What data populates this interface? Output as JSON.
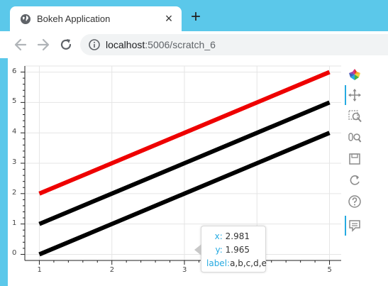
{
  "browser": {
    "tab_title": "Bokeh Application",
    "tab_close": "×",
    "new_tab": "+",
    "url_host": "localhost",
    "url_path": ":5006/scratch_6"
  },
  "tooltip": {
    "x_key": "x:",
    "x_value": "2.981",
    "y_key": "y:",
    "y_value": "1.965",
    "label_key": "label:",
    "label_value": "a,b,c,d,e"
  },
  "toolbar": {
    "tools": [
      "bokeh-logo-icon",
      "pan-icon",
      "box-zoom-icon",
      "wheel-zoom-icon",
      "save-icon",
      "reset-icon",
      "help-icon",
      "hover-icon"
    ]
  },
  "colors": {
    "tab_strip": "#5bc8ea",
    "accent": "#26aae1",
    "red_line": "#ee0000",
    "black_line": "#000000"
  },
  "chart_data": {
    "type": "line",
    "x_ticks": [
      "1",
      "2",
      "3",
      "4",
      "5"
    ],
    "y_ticks": [
      "0",
      "1",
      "2",
      "3",
      "4",
      "5",
      "6"
    ],
    "xlim": [
      0.8,
      5.2
    ],
    "ylim": [
      -0.2,
      6.2
    ],
    "grid": true,
    "series": [
      {
        "color": "#ee0000",
        "x": [
          1,
          2,
          3,
          4,
          5
        ],
        "y": [
          2,
          3,
          4,
          5,
          6
        ]
      },
      {
        "color": "#000000",
        "x": [
          1,
          2,
          3,
          4,
          5
        ],
        "y": [
          1,
          2,
          3,
          4,
          5
        ]
      },
      {
        "color": "#000000",
        "x": [
          1,
          2,
          3,
          4,
          5
        ],
        "y": [
          0,
          1,
          2,
          3,
          4
        ]
      }
    ]
  }
}
